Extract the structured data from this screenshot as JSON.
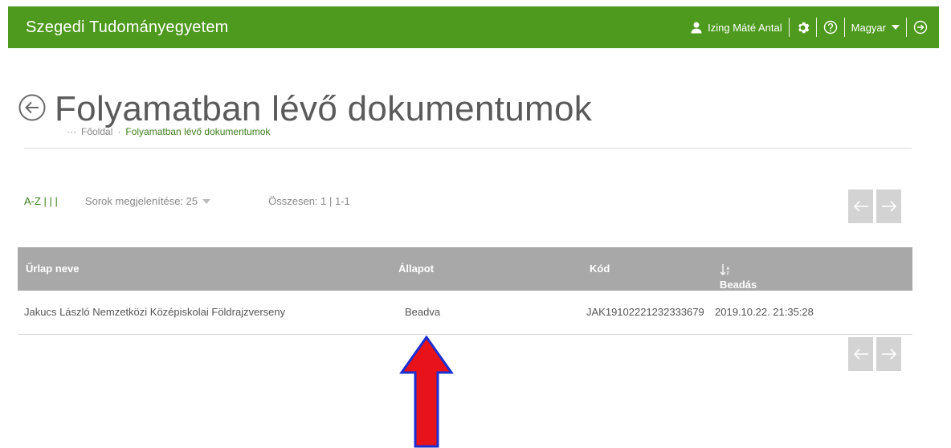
{
  "header": {
    "brand": "Szegedi Tudományegyetem",
    "user": "Izing Máté Antal",
    "language": "Magyar",
    "icons": [
      "user-icon",
      "gear-icon",
      "help-icon",
      "chevron-down-icon",
      "logout-icon"
    ]
  },
  "page": {
    "title": "Folyamatban lévő dokumentumok"
  },
  "breadcrumb": {
    "ellipsis": "···",
    "home": "Főoldal",
    "separator": "·",
    "current": "Folyamatban lévő dokumentumok"
  },
  "toolbar": {
    "sort": "A-Z | | |",
    "rows_label": "Sorok megjelenítése: 25",
    "total": "Összesen: 1 | 1-1"
  },
  "table": {
    "columns": [
      "Űrlap neve",
      "Állapot",
      "Kód",
      "Beadás dátuma"
    ],
    "rows": [
      {
        "name": "Jakucs László Nemzetközi Középiskolai Földrajzverseny",
        "status": "Beadva",
        "code": "JAK19102221232333679",
        "date": "2019.10.22. 21:35:28"
      }
    ]
  },
  "colors": {
    "header_bg": "#4e9a1e",
    "table_header_bg": "#a8a8a8",
    "pager_bg": "#d3d3d3",
    "arrow_fill": "#e8121b",
    "arrow_stroke": "#1c2fd1"
  }
}
